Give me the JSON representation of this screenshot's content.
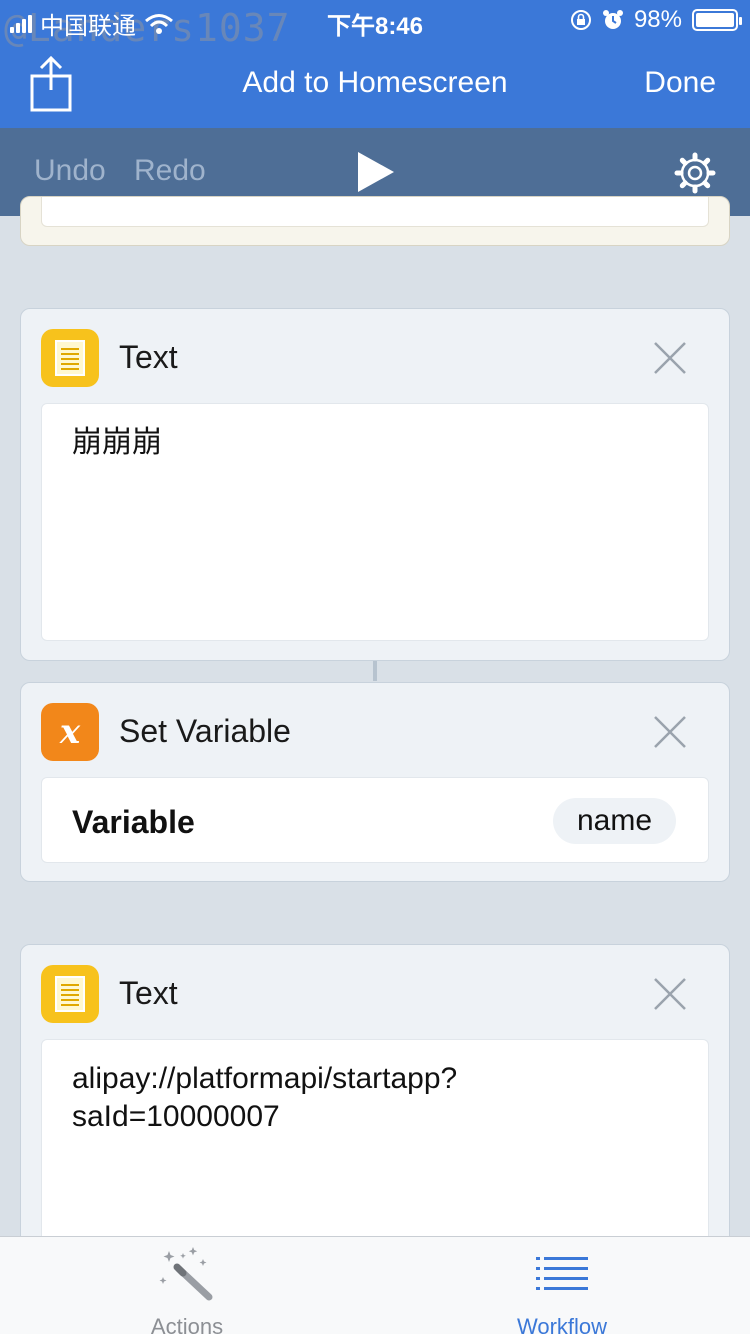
{
  "status": {
    "carrier": "中国联通",
    "time": "下午8:46",
    "battery": "98%",
    "watermark": "@Landers1037"
  },
  "nav": {
    "title": "Add to Homescreen",
    "done_label": "Done"
  },
  "toolbar": {
    "undo_label": "Undo",
    "redo_label": "Redo"
  },
  "cards": {
    "text1": {
      "title": "Text",
      "content": "崩崩崩"
    },
    "setvar": {
      "title": "Set Variable",
      "label": "Variable",
      "value": "name"
    },
    "text2": {
      "title": "Text",
      "content_line1": "alipay://platformapi/startapp?",
      "content_line2": "saId=10000007"
    }
  },
  "tabbar": {
    "actions_label": "Actions",
    "workflow_label": "Workflow"
  },
  "colors": {
    "nav_blue": "#3b78d8",
    "toolbar": "#4e6e96",
    "text_icon": "#f7c21c",
    "variable_icon": "#f2871a"
  }
}
